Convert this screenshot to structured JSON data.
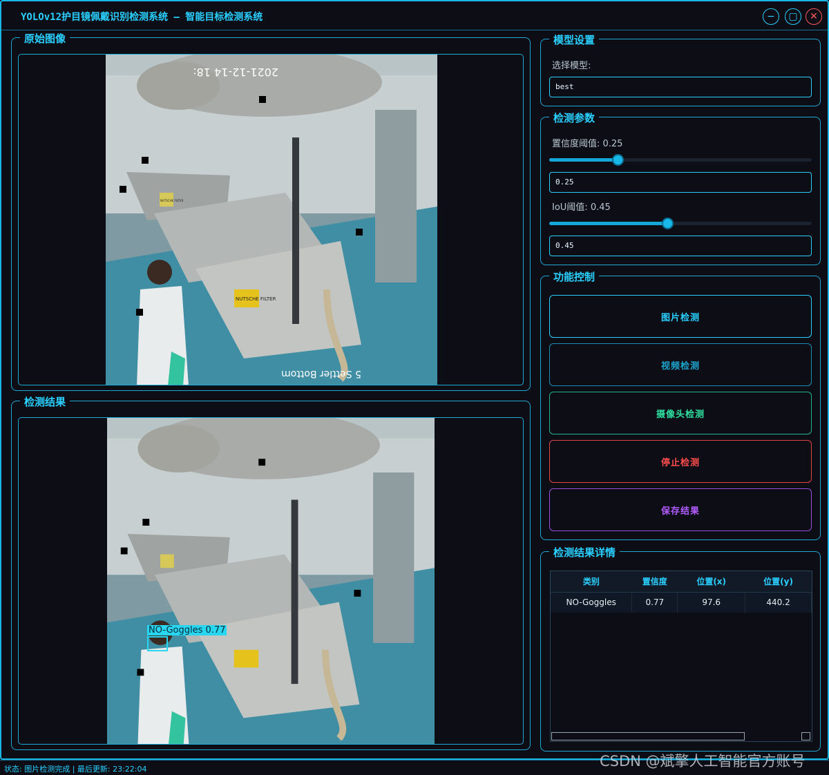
{
  "window": {
    "title": "YOLOv12护目镜佩戴识别检测系统 – 智能目标检测系统",
    "buttons": {
      "minimize": "−",
      "maximize": "▢",
      "close": "✕"
    }
  },
  "panels": {
    "original": {
      "title": "原始图像"
    },
    "result": {
      "title": "检测结果"
    }
  },
  "image_text": {
    "timestamp": "2021-12-14 18:",
    "overlay": "5 Settler Bottom",
    "sign": "NUTSCHE FILTER",
    "sign_small": "NUTSCHE FILTER"
  },
  "detection": {
    "label": "NO-Goggles  0.77"
  },
  "model": {
    "title": "模型设置",
    "select_label": "选择模型:",
    "selected": "best"
  },
  "params": {
    "title": "检测参数",
    "conf_label": "置信度阈值: 0.25",
    "conf_value": "0.25",
    "conf_level": 0.25,
    "iou_label": "IoU阈值: 0.45",
    "iou_value": "0.45",
    "iou_level": 0.45
  },
  "controls": {
    "title": "功能控制",
    "image_btn": "图片检测",
    "video_btn": "视频检测",
    "camera_btn": "摄像头检测",
    "stop_btn": "停止检测",
    "save_btn": "保存结果"
  },
  "colors": {
    "accent": "#2ad0ff",
    "camera": "#2fe0a0",
    "stop": "#ff4d4d",
    "save": "#b35cff"
  },
  "details": {
    "title": "检测结果详情",
    "headers": [
      "类别",
      "置信度",
      "位置(x)",
      "位置(y)"
    ],
    "rows": [
      [
        "NO-Goggles",
        "0.77",
        "97.6",
        "440.2"
      ]
    ]
  },
  "status": {
    "text": "状态: 图片检测完成 | 最后更新: 23:22:04"
  },
  "watermark": "CSDN @斌擎人工智能官方账号"
}
